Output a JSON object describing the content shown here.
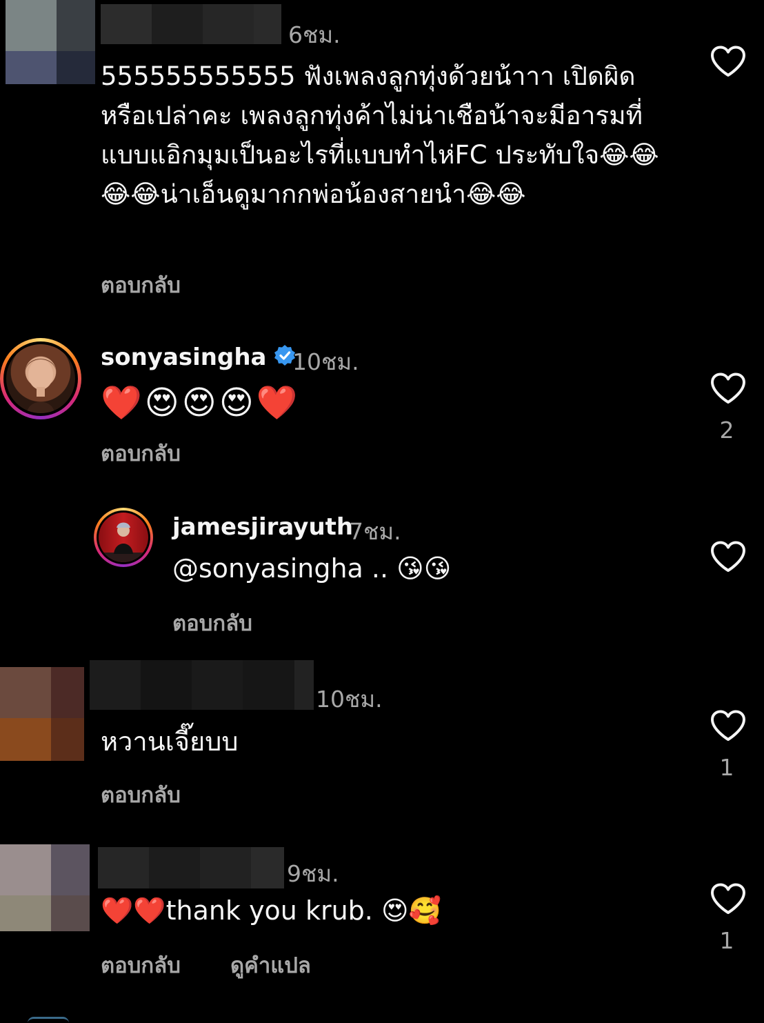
{
  "colors": {
    "background": "#000000",
    "text_primary": "#f5f5f5",
    "text_secondary": "#a8a8a8",
    "verified_blue": "#3897f0",
    "heart_outline": "#f5f5f5"
  },
  "comments": [
    {
      "username": "",
      "time": "6ชม.",
      "text": "555555555555 ฟังเพลงลูกทุ่งด้วยน้าาา เปิดผิดหรือเปล่าคะ เพลงลูกทุ่งค้าไม่น่าเชือน้าจะมีอารมที่แบบแอิกมุมเป็นอะไรที่แบบทำไห่FC ประทับใจ😂😂😂😂น่าเอ็นดูมากกพ่อน้องสายนำ😂😂",
      "reply_label": "ตอบกลับ",
      "likes": ""
    },
    {
      "username": "sonyasingha",
      "verified": true,
      "time": "10ชม.",
      "text": "❤️😍😍😍❤️",
      "reply_label": "ตอบกลับ",
      "likes": "2"
    },
    {
      "username": "jamesjirayuth",
      "time": "7ชม.",
      "text": "@sonyasingha .. 😘😘",
      "reply_label": "ตอบกลับ",
      "likes": ""
    },
    {
      "username": "",
      "time": "10ชม.",
      "text": "หวานเจี๊ยบบ",
      "reply_label": "ตอบกลับ",
      "likes": "1"
    },
    {
      "username": "",
      "time": "9ชม.",
      "text": "❤️❤️thank you krub. 😍🥰",
      "reply_label": "ตอบกลับ",
      "translate_label": "ดูคำแปล",
      "likes": "1"
    }
  ]
}
